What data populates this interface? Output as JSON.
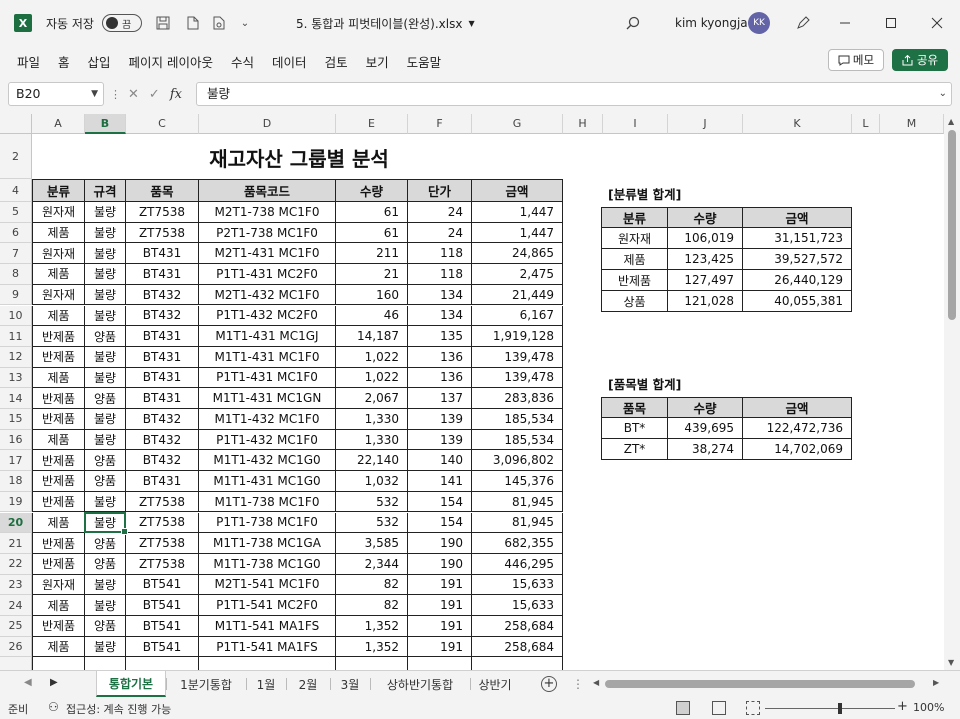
{
  "titlebar": {
    "autosave_label": "자동 저장",
    "toggle_state": "끔",
    "filename": "5. 통합과 피벗테이블(완성).xlsx",
    "user": "kim kyongja",
    "avatar_initials": "KK"
  },
  "menu": {
    "items": [
      "파일",
      "홈",
      "삽입",
      "페이지 레이아웃",
      "수식",
      "데이터",
      "검토",
      "보기",
      "도움말"
    ],
    "memo_label": "메모",
    "share_label": "공유"
  },
  "formula": {
    "cell_ref": "B20",
    "fx": "fx",
    "content": "불량"
  },
  "columns": [
    "A",
    "B",
    "C",
    "D",
    "E",
    "F",
    "G",
    "H",
    "I",
    "J",
    "K",
    "L",
    "M"
  ],
  "rows": [
    "2",
    "4",
    "5",
    "6",
    "7",
    "8",
    "9",
    "10",
    "11",
    "12",
    "13",
    "14",
    "15",
    "16",
    "17",
    "18",
    "19",
    "20",
    "21",
    "22",
    "23",
    "24",
    "25",
    "26"
  ],
  "sheet_title": "재고자산 그룹별 분석",
  "main_table": {
    "headers": [
      "분류",
      "규격",
      "품목",
      "품목코드",
      "수량",
      "단가",
      "금액"
    ],
    "rows": [
      [
        "원자재",
        "불량",
        "ZT7538",
        "M2T1-738 MC1F0",
        "61",
        "24",
        "1,447"
      ],
      [
        "제품",
        "불량",
        "ZT7538",
        "P2T1-738 MC1F0",
        "61",
        "24",
        "1,447"
      ],
      [
        "원자재",
        "불량",
        "BT431",
        "M2T1-431 MC1F0",
        "211",
        "118",
        "24,865"
      ],
      [
        "제품",
        "불량",
        "BT431",
        "P1T1-431 MC2F0",
        "21",
        "118",
        "2,475"
      ],
      [
        "원자재",
        "불량",
        "BT432",
        "M2T1-432 MC1F0",
        "160",
        "134",
        "21,449"
      ],
      [
        "제품",
        "불량",
        "BT432",
        "P1T1-432 MC2F0",
        "46",
        "134",
        "6,167"
      ],
      [
        "반제품",
        "양품",
        "BT431",
        "M1T1-431 MC1GJ",
        "14,187",
        "135",
        "1,919,128"
      ],
      [
        "반제품",
        "불량",
        "BT431",
        "M1T1-431 MC1F0",
        "1,022",
        "136",
        "139,478"
      ],
      [
        "제품",
        "불량",
        "BT431",
        "P1T1-431 MC1F0",
        "1,022",
        "136",
        "139,478"
      ],
      [
        "반제품",
        "양품",
        "BT431",
        "M1T1-431 MC1GN",
        "2,067",
        "137",
        "283,836"
      ],
      [
        "반제품",
        "불량",
        "BT432",
        "M1T1-432 MC1F0",
        "1,330",
        "139",
        "185,534"
      ],
      [
        "제품",
        "불량",
        "BT432",
        "P1T1-432 MC1F0",
        "1,330",
        "139",
        "185,534"
      ],
      [
        "반제품",
        "양품",
        "BT432",
        "M1T1-432 MC1G0",
        "22,140",
        "140",
        "3,096,802"
      ],
      [
        "반제품",
        "양품",
        "BT431",
        "M1T1-431 MC1G0",
        "1,032",
        "141",
        "145,376"
      ],
      [
        "반제품",
        "불량",
        "ZT7538",
        "M1T1-738 MC1F0",
        "532",
        "154",
        "81,945"
      ],
      [
        "제품",
        "불량",
        "ZT7538",
        "P1T1-738 MC1F0",
        "532",
        "154",
        "81,945"
      ],
      [
        "반제품",
        "양품",
        "ZT7538",
        "M1T1-738 MC1GA",
        "3,585",
        "190",
        "682,355"
      ],
      [
        "반제품",
        "양품",
        "ZT7538",
        "M1T1-738 MC1G0",
        "2,344",
        "190",
        "446,295"
      ],
      [
        "원자재",
        "불량",
        "BT541",
        "M2T1-541 MC1F0",
        "82",
        "191",
        "15,633"
      ],
      [
        "제품",
        "불량",
        "BT541",
        "P1T1-541 MC2F0",
        "82",
        "191",
        "15,633"
      ],
      [
        "반제품",
        "양품",
        "BT541",
        "M1T1-541 MA1FS",
        "1,352",
        "191",
        "258,684"
      ],
      [
        "제품",
        "불량",
        "BT541",
        "P1T1-541 MA1FS",
        "1,352",
        "191",
        "258,684"
      ]
    ]
  },
  "cat_summary": {
    "title": "[분류별 합계]",
    "headers": [
      "분류",
      "수량",
      "금액"
    ],
    "rows": [
      [
        "원자재",
        "106,019",
        "31,151,723"
      ],
      [
        "제품",
        "123,425",
        "39,527,572"
      ],
      [
        "반제품",
        "127,497",
        "26,440,129"
      ],
      [
        "상품",
        "121,028",
        "40,055,381"
      ]
    ]
  },
  "item_summary": {
    "title": "[품목별 합계]",
    "headers": [
      "품목",
      "수량",
      "금액"
    ],
    "rows": [
      [
        "BT*",
        "439,695",
        "122,472,736"
      ],
      [
        "ZT*",
        "38,274",
        "14,702,069"
      ]
    ]
  },
  "sheet_tabs": [
    "통합기본",
    "1분기통합",
    "1월",
    "2월",
    "3월",
    "상하반기통합",
    "상반기"
  ],
  "active_tab": "통합기본",
  "status": {
    "ready": "준비",
    "accessibility": "접근성: 계속 진행 가능",
    "zoom": "100%"
  }
}
